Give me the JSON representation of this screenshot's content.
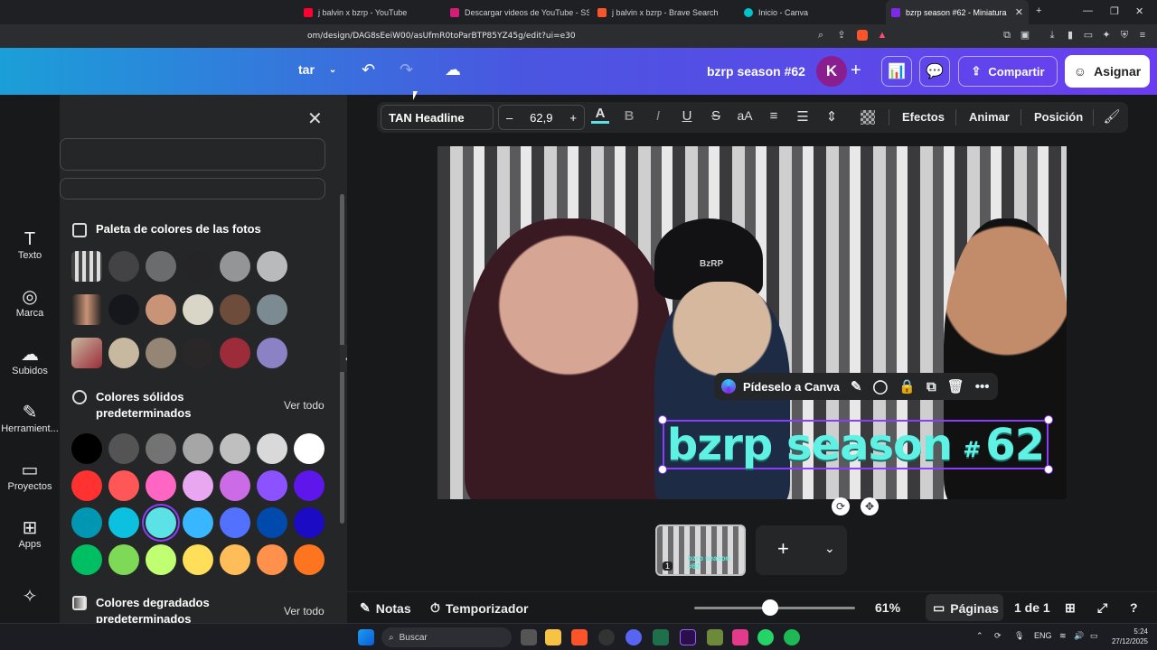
{
  "browser": {
    "tabs": [
      {
        "label": "j balvin x bzrp - YouTube",
        "color": "#ff0033"
      },
      {
        "label": "Descargar videos de YouTube - SSYo",
        "color": "#d51c77"
      },
      {
        "label": "j balvin x bzrp - Brave Search",
        "color": "#fb542b"
      },
      {
        "label": "Inicio - Canva",
        "color": "#00c4cc"
      },
      {
        "label": "bzrp season #62 - Miniatura par",
        "color": "#7d2ae8"
      }
    ],
    "new_tab": "+",
    "url": "om/design/DAG8sEeiW00/asUfmR0toParBTP85YZ45g/edit?ui=e30"
  },
  "header": {
    "menu_label": "tar",
    "design_title": "bzrp season #62",
    "avatar_letter": "K",
    "share_label": "Compartir",
    "assign_label": "Asignar"
  },
  "rail": [
    {
      "label": "Texto",
      "icon": "text-icon"
    },
    {
      "label": "Marca",
      "icon": "brand-icon"
    },
    {
      "label": "Subidos",
      "icon": "upload-icon"
    },
    {
      "label": "Herramient...",
      "icon": "tools-icon"
    },
    {
      "label": "Proyectos",
      "icon": "folder-icon"
    },
    {
      "label": "Apps",
      "icon": "apps-icon"
    },
    {
      "label": "",
      "icon": "magic-media-icon"
    }
  ],
  "panel": {
    "photo_palette_title": "Paleta de colores de las fotos",
    "photo_palettes": [
      [
        "#434345",
        "#6b6c6e",
        "#252527",
        "#949597",
        "#b9babc"
      ],
      [
        "#16171c",
        "#c99377",
        "#d9d6c8",
        "#6e4c3c",
        "#7c8a92"
      ],
      [
        "#c7b9a0",
        "#948574",
        "#2a2729",
        "#9c2c3a",
        "#8a82c4"
      ]
    ],
    "solid_title": "Colores sólidos predeterminados",
    "solid_see_all": "Ver todo",
    "solid_colors": [
      [
        "#000000",
        "#545454",
        "#737373",
        "#a6a6a6",
        "#bfbfbf",
        "#d9d9d9",
        "#ffffff"
      ],
      [
        "#ff3131",
        "#ff5757",
        "#ff66c4",
        "#e8a7f0",
        "#cb6ce6",
        "#8c52ff",
        "#5e17eb"
      ],
      [
        "#0097b2",
        "#0cc0df",
        "#5ce1e6",
        "#38b6ff",
        "#5271ff",
        "#004aad",
        "#1b0bc4"
      ],
      [
        "#00bf63",
        "#7ed957",
        "#c1ff72",
        "#ffde59",
        "#ffbd59",
        "#ff914d",
        "#ff751f"
      ]
    ],
    "gradient_title": "Colores degradados predeterminados",
    "gradient_see_all": "Ver todo"
  },
  "toolbar": {
    "font": "TAN Headline",
    "size": "62,9",
    "minus": "–",
    "plus": "+",
    "case": "aA",
    "effects": "Efectos",
    "animate": "Animar",
    "position": "Posición"
  },
  "canvas": {
    "headline_main": "bzrp season",
    "headline_hash": "#",
    "headline_num": "62",
    "cap_text": "BzRP",
    "context_ask": "Pídeselo a Canva"
  },
  "pages": {
    "thumb_num": "1",
    "thumb_text": "bzrp season #62"
  },
  "footer": {
    "notes": "Notas",
    "timer": "Temporizador",
    "zoom": "61%",
    "zoom_fraction": 0.61,
    "pages_label": "Páginas",
    "page_count": "1 de 1"
  },
  "taskbar": {
    "search": "Buscar",
    "lang": "ENG",
    "time": "5:24",
    "date": "27/12/2025"
  }
}
